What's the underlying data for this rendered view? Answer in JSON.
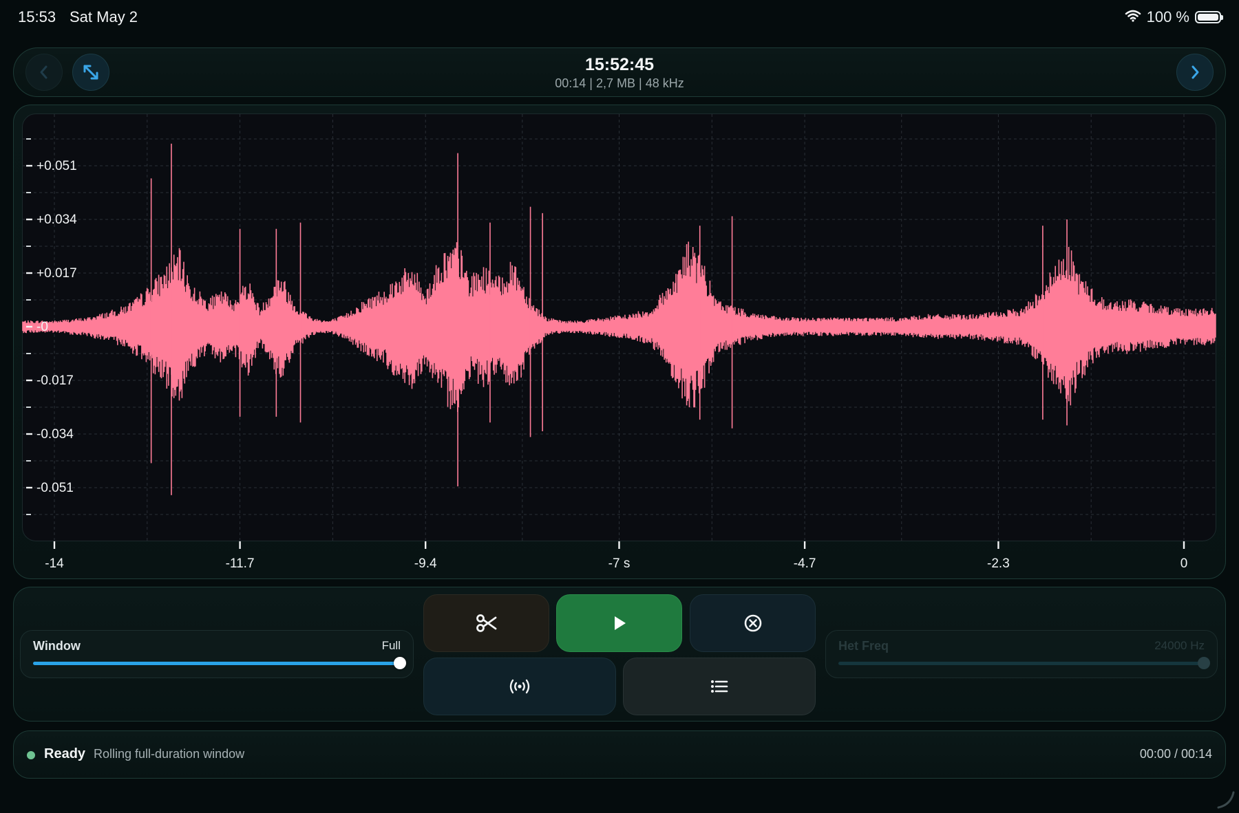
{
  "status_bar": {
    "time": "15:53",
    "date": "Sat May 2",
    "battery": "100 %"
  },
  "header": {
    "title": "15:52:45",
    "subtitle": "00:14 | 2,7 MB | 48 kHz"
  },
  "chart_data": {
    "type": "line",
    "title": "",
    "xlabel": "",
    "ylabel": "",
    "xlim": [
      -14,
      0
    ],
    "ylim": [
      -0.068,
      0.068
    ],
    "x_ticks": [
      "-14",
      "-11.7",
      "-9.4",
      "-7 s",
      "-4.7",
      "-2.3",
      "0"
    ],
    "x_tick_values": [
      -14,
      -11.7,
      -9.4,
      -7,
      -4.7,
      -2.3,
      0
    ],
    "y_ticks": [
      "+0.051",
      "+0.034",
      "+0.017",
      "-0",
      "-0.017",
      "-0.034",
      "-0.051"
    ],
    "y_tick_values": [
      0.051,
      0.034,
      0.017,
      0,
      -0.017,
      -0.034,
      -0.051
    ],
    "grid": true,
    "series": [
      {
        "color": "#ff7d98",
        "envelope": {
          "x": [
            -14,
            -13.6,
            -13.2,
            -13.0,
            -12.8,
            -12.55,
            -12.45,
            -12.3,
            -12.1,
            -11.9,
            -11.8,
            -11.6,
            -11.45,
            -11.2,
            -11.0,
            -10.8,
            -10.6,
            -10.4,
            -10.2,
            -9.9,
            -9.7,
            -9.55,
            -9.4,
            -9.2,
            -9.0,
            -8.85,
            -8.7,
            -8.5,
            -8.3,
            -8.1,
            -7.9,
            -7.7,
            -7.5,
            -7.2,
            -6.9,
            -6.6,
            -6.3,
            -6.15,
            -6.0,
            -5.8,
            -5.6,
            -5.4,
            -5.2,
            -5.0,
            -4.7,
            -4.4,
            -4.1,
            -3.8,
            -3.5,
            -3.2,
            -2.9,
            -2.6,
            -2.3,
            -2.0,
            -1.8,
            -1.55,
            -1.45,
            -1.3,
            -1.1,
            -0.9,
            -0.7,
            -0.5,
            -0.3,
            0
          ],
          "amplitude": [
            0.002,
            0.003,
            0.006,
            0.009,
            0.014,
            0.022,
            0.025,
            0.014,
            0.009,
            0.012,
            0.008,
            0.016,
            0.006,
            0.018,
            0.007,
            0.003,
            0.002,
            0.004,
            0.008,
            0.013,
            0.018,
            0.02,
            0.012,
            0.024,
            0.028,
            0.016,
            0.02,
            0.016,
            0.022,
            0.009,
            0.003,
            0.002,
            0.002,
            0.003,
            0.004,
            0.006,
            0.018,
            0.028,
            0.024,
            0.009,
            0.007,
            0.005,
            0.004,
            0.003,
            0.003,
            0.003,
            0.003,
            0.003,
            0.003,
            0.004,
            0.004,
            0.004,
            0.005,
            0.006,
            0.012,
            0.022,
            0.028,
            0.018,
            0.011,
            0.008,
            0.009,
            0.008,
            0.007,
            0.006
          ]
        },
        "spikes": [
          {
            "x": -12.8,
            "value": 0.047
          },
          {
            "x": -12.55,
            "value": 0.058
          },
          {
            "x": -11.7,
            "value": 0.031
          },
          {
            "x": -11.25,
            "value": 0.031
          },
          {
            "x": -10.95,
            "value": 0.033
          },
          {
            "x": -9.0,
            "value": 0.055
          },
          {
            "x": -8.6,
            "value": 0.033
          },
          {
            "x": -8.1,
            "value": 0.038
          },
          {
            "x": -7.95,
            "value": 0.036
          },
          {
            "x": -6.0,
            "value": 0.032
          },
          {
            "x": -5.6,
            "value": 0.035
          },
          {
            "x": -1.75,
            "value": 0.032
          },
          {
            "x": -1.45,
            "value": 0.034
          }
        ]
      }
    ]
  },
  "actions": {
    "cut_icon": "scissors-icon",
    "play_icon": "play-icon",
    "cancel_icon": "cancel-circle-icon",
    "broadcast_icon": "broadcast-icon",
    "list_icon": "list-icon"
  },
  "window_slider": {
    "label": "Window",
    "value": "Full",
    "level": 1.0
  },
  "het_slider": {
    "label": "Het Freq",
    "value": "24000 Hz",
    "level": 1.0
  },
  "status": {
    "state": "Ready",
    "message": "Rolling full-duration window",
    "time": "00:00 / 00:14"
  }
}
